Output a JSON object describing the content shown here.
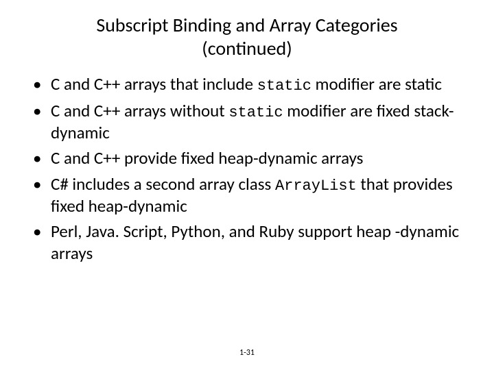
{
  "title_line1": "Subscript Binding and Array Categories",
  "title_line2": "(continued)",
  "bullets": {
    "b1a": "C and C++ arrays that include ",
    "b1code": "static",
    "b1b": " modifier are static",
    "b2a": "C and C++ arrays without ",
    "b2code": "static",
    "b2b": " modifier are fixed stack-dynamic",
    "b3": "C and C++ provide fixed heap-dynamic arrays",
    "b4a": "C# includes a second array class ",
    "b4code": "ArrayList",
    "b4b": " that provides fixed heap-dynamic",
    "b5": "Perl, Java. Script, Python, and Ruby support heap -dynamic arrays"
  },
  "pagenum": "1-31"
}
